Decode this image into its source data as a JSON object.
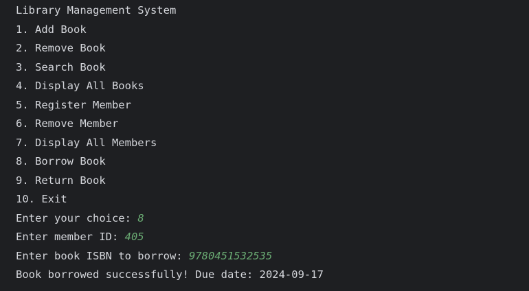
{
  "console": {
    "title": "Library Management System",
    "menu_items": [
      "1. Add Book",
      "2. Remove Book",
      "3. Search Book",
      "4. Display All Books",
      "5. Register Member",
      "6. Remove Member",
      "7. Display All Members",
      "8. Borrow Book",
      "9. Return Book",
      "10. Exit"
    ],
    "prompts": {
      "choice_label": "Enter your choice: ",
      "choice_value": "8",
      "member_label": "Enter member ID: ",
      "member_value": "405",
      "isbn_label": "Enter book ISBN to borrow: ",
      "isbn_value": "9780451532535"
    },
    "result_message": "Book borrowed successfully! Due date: 2024-09-17"
  },
  "colors": {
    "background": "#1e1f22",
    "text": "#d4d6db",
    "user_input": "#6aab73"
  }
}
